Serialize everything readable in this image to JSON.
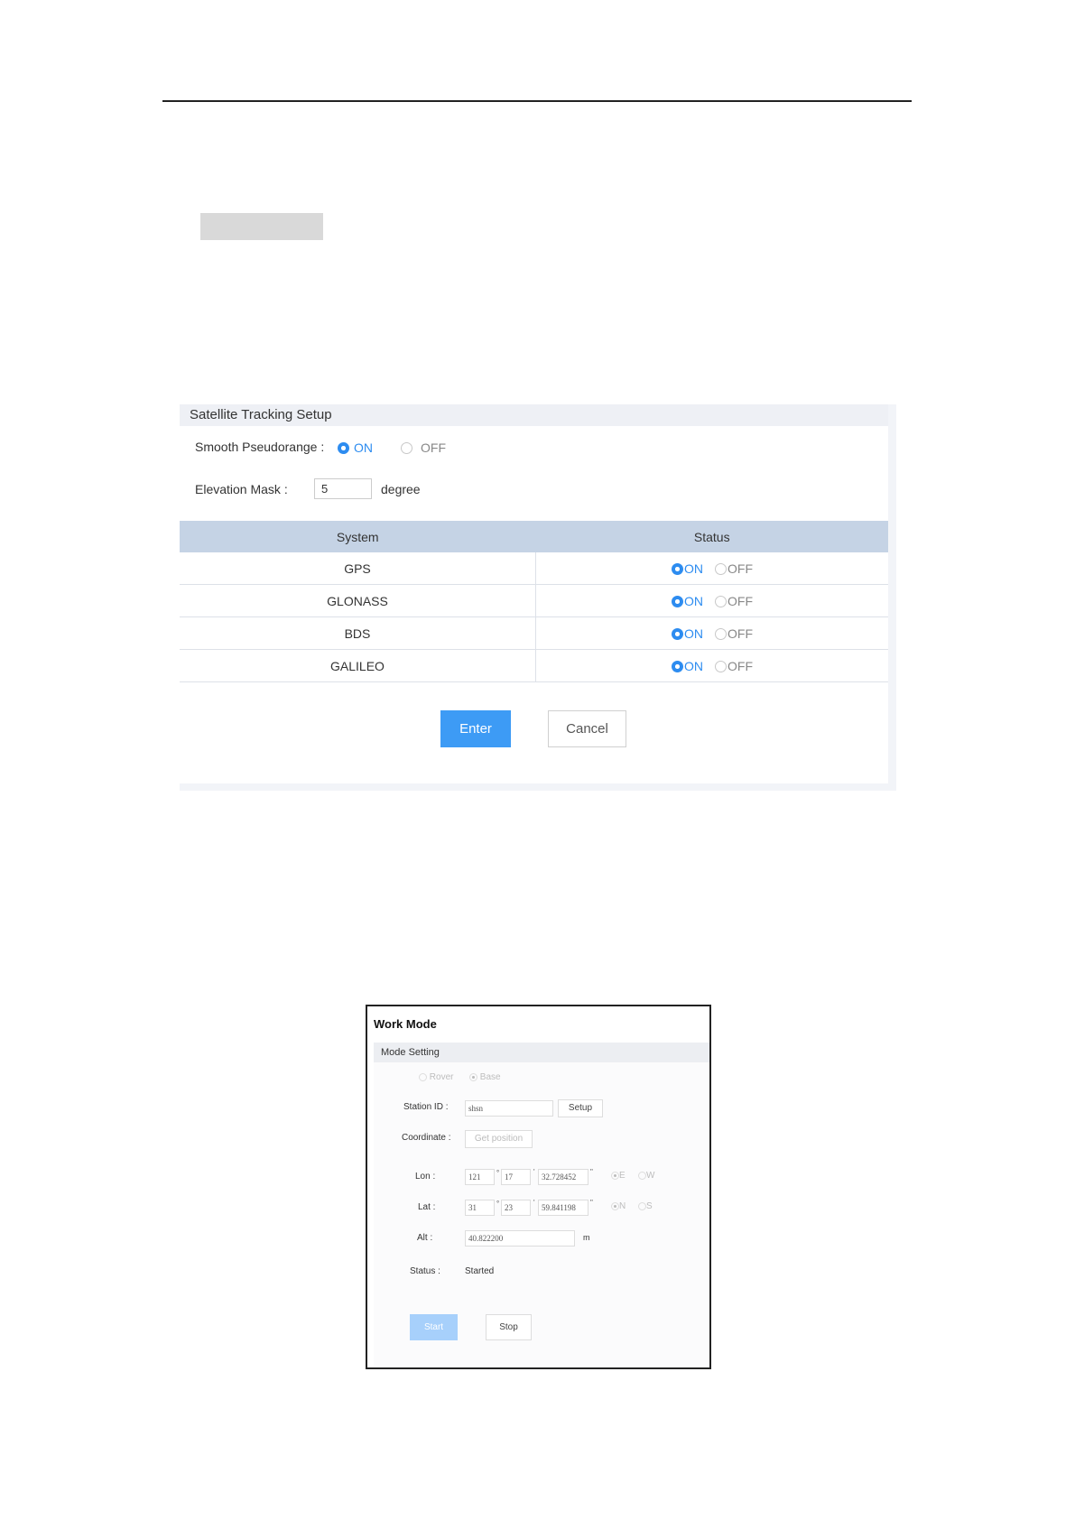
{
  "satellite_panel": {
    "title": "Satellite Tracking Setup",
    "smooth_label": "Smooth Pseudorange :",
    "on_label": "ON",
    "off_label": "OFF",
    "elevation_label": "Elevation Mask :",
    "elevation_value": "5",
    "elevation_unit": "degree",
    "table_headers": [
      "System",
      "Status"
    ],
    "systems": [
      {
        "name": "GPS",
        "status": "ON"
      },
      {
        "name": "GLONASS",
        "status": "ON"
      },
      {
        "name": "BDS",
        "status": "ON"
      },
      {
        "name": "GALILEO",
        "status": "ON"
      }
    ],
    "enter_label": "Enter",
    "cancel_label": "Cancel",
    "accent_color": "#2d8cf0"
  },
  "work_mode": {
    "title": "Work Mode",
    "section": "Mode Setting",
    "mode_rover": "Rover",
    "mode_base": "Base",
    "station_id_label": "Station ID :",
    "station_id_value": "shsn",
    "setup_label": "Setup",
    "coordinate_label": "Coordinate :",
    "get_position_label": "Get position",
    "lon_label": "Lon :",
    "lon_deg": "121",
    "lon_min": "17",
    "lon_sec": "32.728452",
    "lon_e": "E",
    "lon_w": "W",
    "lat_label": "Lat :",
    "lat_deg": "31",
    "lat_min": "23",
    "lat_sec": "59.841198",
    "lat_n": "N",
    "lat_s": "S",
    "alt_label": "Alt :",
    "alt_value": "40.822200",
    "alt_unit": "m",
    "status_label": "Status :",
    "status_value": "Started",
    "start_label": "Start",
    "stop_label": "Stop"
  }
}
